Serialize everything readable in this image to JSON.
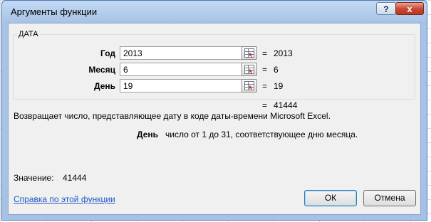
{
  "dialog": {
    "title": "Аргументы функции",
    "help_glyph": "?",
    "close_glyph": "x"
  },
  "function_group": {
    "name": "ДАТА",
    "args": [
      {
        "label": "Год",
        "value": "2013",
        "result": "2013"
      },
      {
        "label": "Месяц",
        "value": "6",
        "result": "6"
      },
      {
        "label": "День",
        "value": "19",
        "result": "19"
      }
    ],
    "eq_sign": "="
  },
  "result": {
    "eq_sign": "=",
    "value": "41444"
  },
  "description": "Возвращает число, представляющее дату в коде даты-времени Microsoft Excel.",
  "arg_help": {
    "name": "День",
    "text": "число от 1 до 31, соответствующее дню месяца."
  },
  "value_line": {
    "label": "Значение:",
    "value": "41444"
  },
  "help_link": "Справка по этой функции",
  "buttons": {
    "ok": "ОК",
    "cancel": "Отмена"
  }
}
